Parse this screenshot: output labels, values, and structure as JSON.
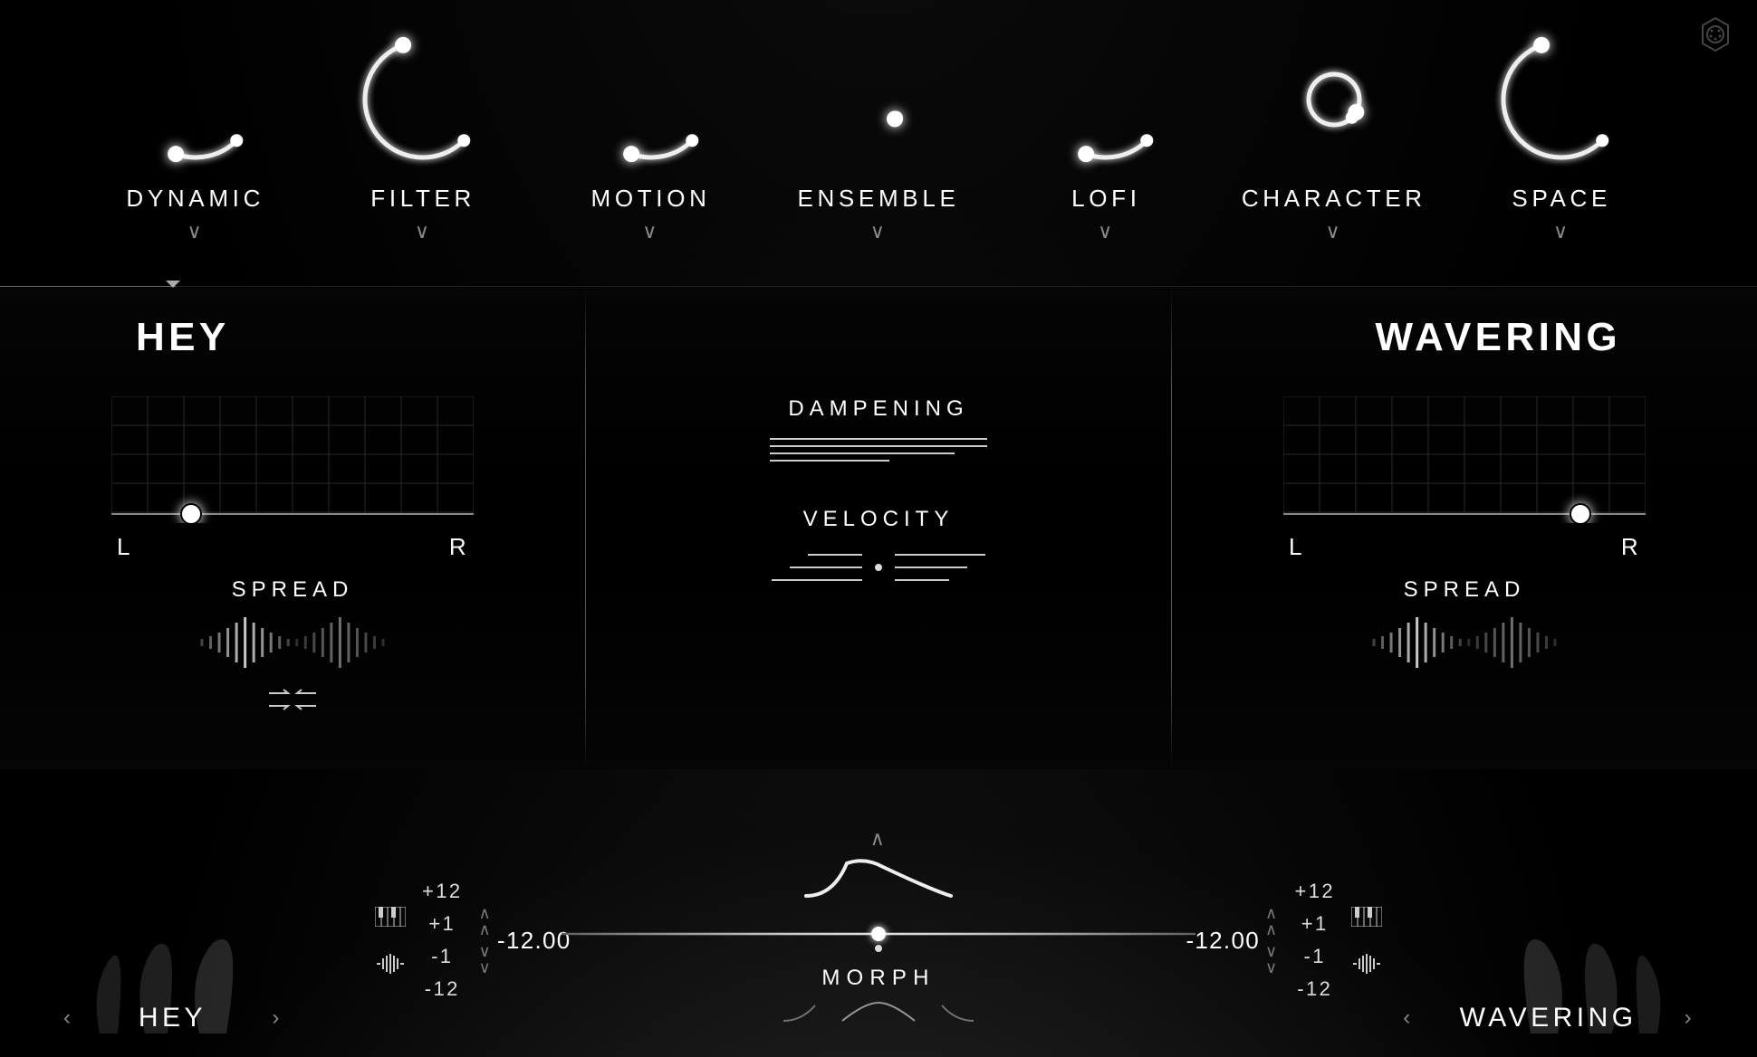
{
  "knobs": [
    {
      "label": "DYNAMIC",
      "angle": 200
    },
    {
      "label": "FILTER",
      "angle": 340
    },
    {
      "label": "MOTION",
      "angle": 200
    },
    {
      "label": "ENSEMBLE",
      "angle": 140,
      "small": true
    },
    {
      "label": "LOFI",
      "angle": 200
    },
    {
      "label": "CHARACTER",
      "angle": 120,
      "small": true
    },
    {
      "label": "SPACE",
      "angle": 340
    }
  ],
  "left": {
    "preset": "HEY",
    "pan_pos": 0.22,
    "spread": "SPREAD",
    "L": "L",
    "R": "R"
  },
  "right": {
    "preset": "WAVERING",
    "pan_pos": 0.82,
    "spread": "SPREAD",
    "L": "L",
    "R": "R"
  },
  "center": {
    "dampening": "DAMPENING",
    "velocity": "VELOCITY"
  },
  "bottom": {
    "left_source": "HEY",
    "right_source": "WAVERING",
    "tune_left": "-12.00",
    "tune_right": "-12.00",
    "pitch_steps": [
      "+12",
      "+1",
      "-1",
      "-12"
    ],
    "morph_label": "MORPH",
    "morph_pos": 0.5
  }
}
